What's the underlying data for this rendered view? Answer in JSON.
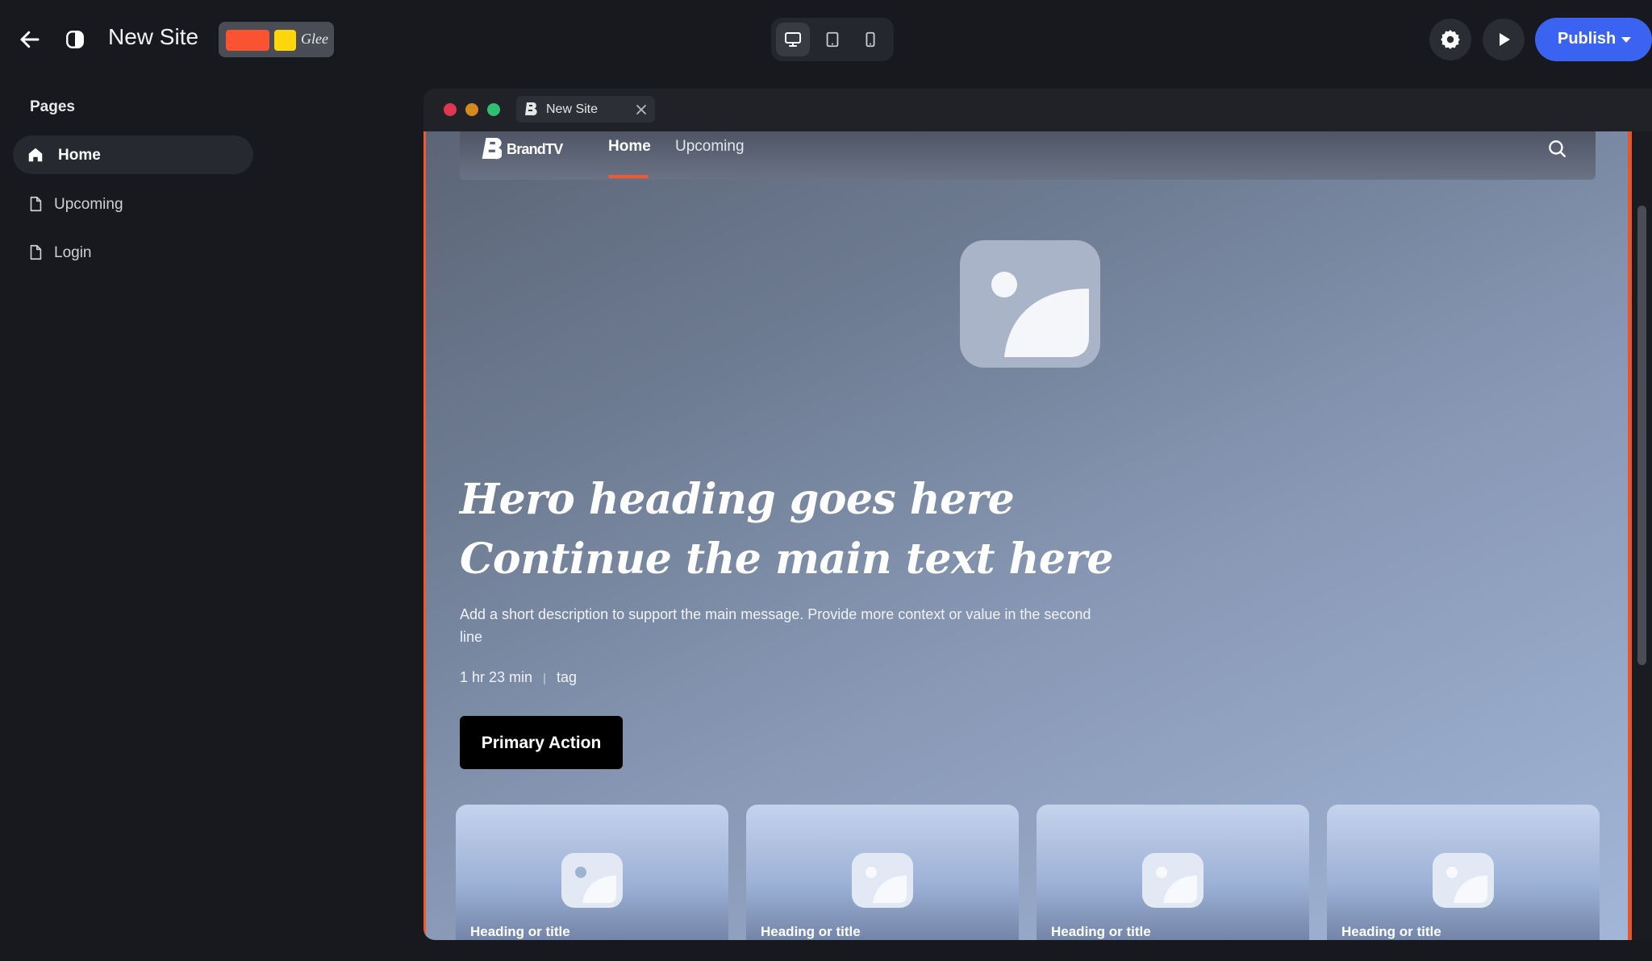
{
  "topbar": {
    "site_title": "New Site",
    "theme_font_sample": "Glee",
    "theme_colors": [
      "#fa5331",
      "#ffd60a"
    ],
    "publish_label": "Publish",
    "active_device": "desktop"
  },
  "sidebar": {
    "heading": "Pages",
    "items": [
      {
        "label": "Home",
        "icon": "home-icon",
        "active": true
      },
      {
        "label": "Upcoming",
        "icon": "page-icon",
        "active": false
      },
      {
        "label": "Login",
        "icon": "page-icon",
        "active": false
      }
    ]
  },
  "preview": {
    "tab_title": "New Site",
    "site": {
      "brand": "BrandTV",
      "nav": [
        "Home",
        "Upcoming"
      ],
      "hero": {
        "heading_line1": "Hero heading goes here",
        "heading_line2": "Continue the main text here",
        "description": "Add a short description to support the main message. Provide more context or value in the second line",
        "duration": "1 hr 23 min",
        "separator": "|",
        "tag": "tag",
        "cta": "Primary Action"
      },
      "cards": [
        {
          "title": "Heading or title"
        },
        {
          "title": "Heading or title"
        },
        {
          "title": "Heading or title"
        },
        {
          "title": "Heading or title"
        }
      ]
    }
  },
  "colors": {
    "accent": "#f05a2d",
    "publish": "#3a63f2",
    "background": "#17191e"
  }
}
